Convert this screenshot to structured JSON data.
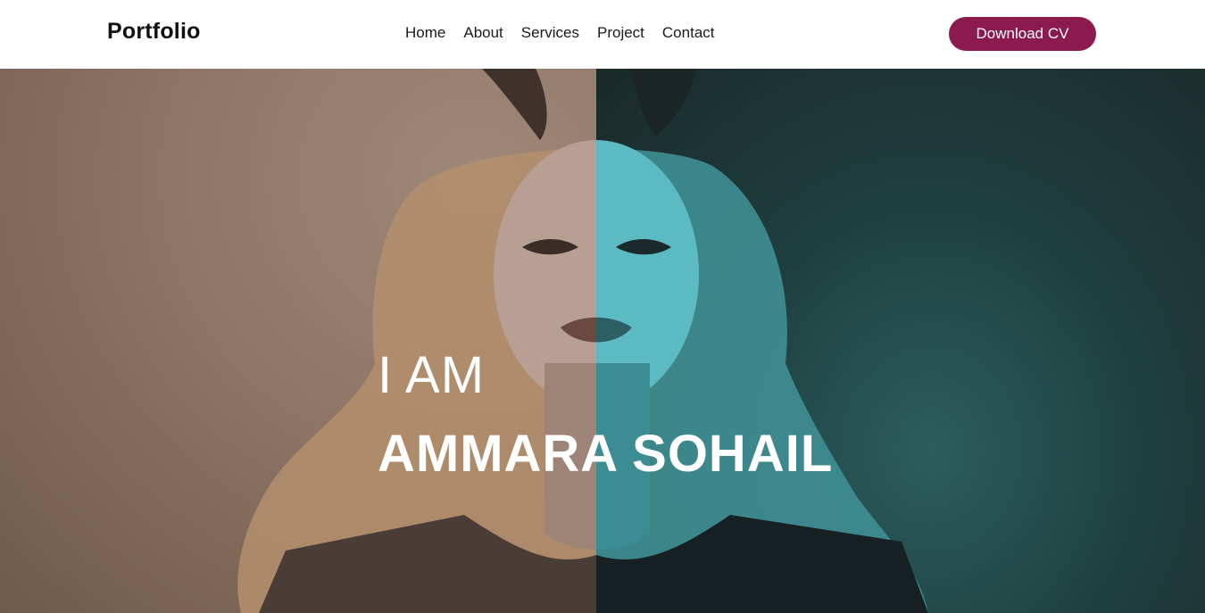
{
  "navbar": {
    "brand": "Portfolio",
    "links": [
      "Home",
      "About",
      "Services",
      "Project",
      "Contact"
    ],
    "cta_label": "Download CV"
  },
  "hero": {
    "intro": "I AM",
    "name": "AMMARA SOHAIL",
    "image": "split-tone-portrait-photo"
  },
  "colors": {
    "accent": "#8b1a4f",
    "hero_left_tone": "#8e7565",
    "hero_right_tone": "#1f3f3f",
    "hero_text": "#ffffff"
  }
}
